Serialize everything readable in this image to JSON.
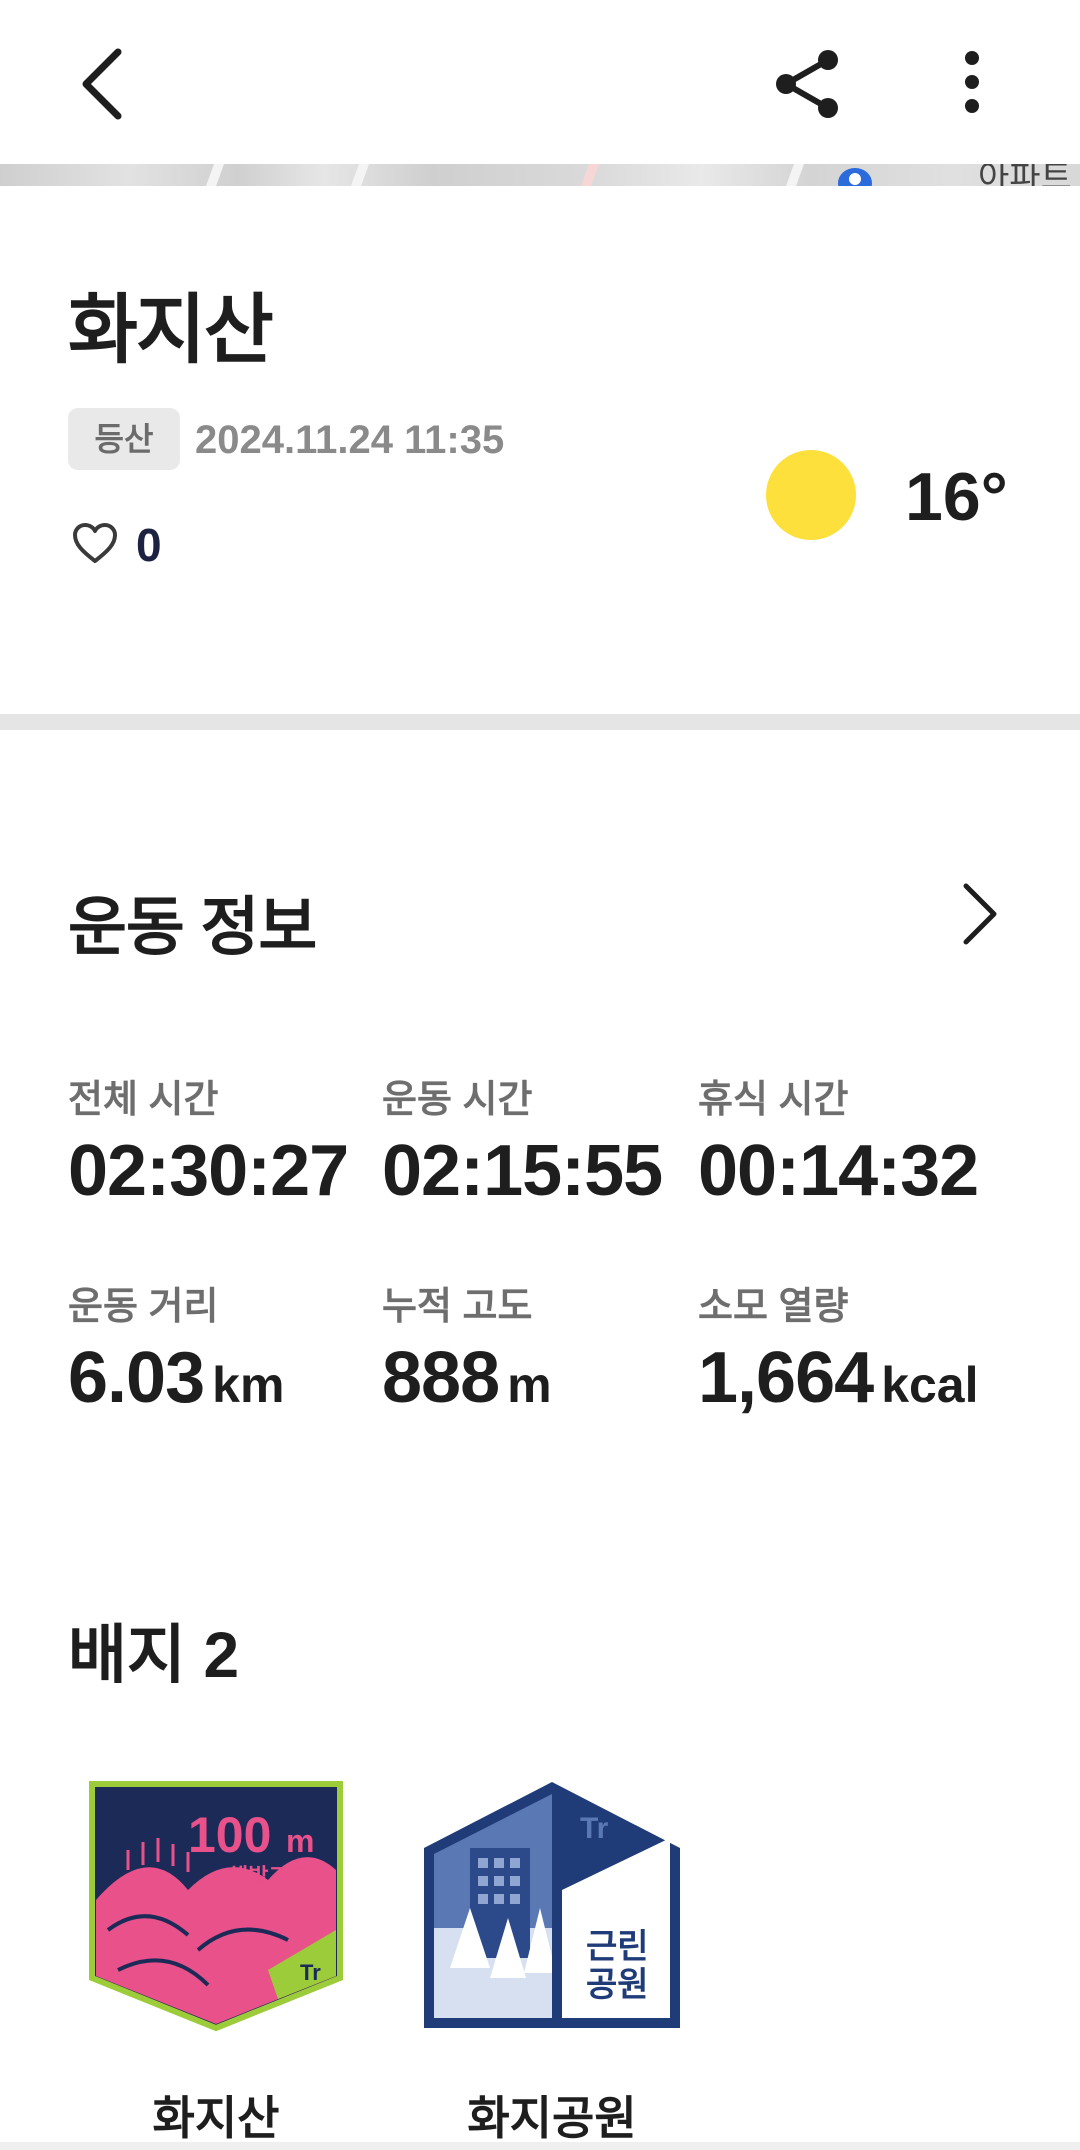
{
  "header": {
    "back_icon": "chevron-left-icon",
    "share_icon": "share-icon",
    "more_icon": "more-vertical-icon"
  },
  "map": {
    "label": "아파트"
  },
  "record": {
    "title": "화지산",
    "tag": "등산",
    "datetime": "2024.11.24 11:35",
    "like_count": "0",
    "weather_icon": "sun-icon",
    "temperature": "16°"
  },
  "exercise": {
    "section_title": "운동 정보",
    "stats": [
      {
        "label": "전체 시간",
        "value": "02:30:27",
        "unit": ""
      },
      {
        "label": "운동 시간",
        "value": "02:15:55",
        "unit": ""
      },
      {
        "label": "휴식 시간",
        "value": "00:14:32",
        "unit": ""
      },
      {
        "label": "운동 거리",
        "value": "6.03",
        "unit": "km"
      },
      {
        "label": "누적 고도",
        "value": "888",
        "unit": "m"
      },
      {
        "label": "소모 열량",
        "value": "1,664",
        "unit": "kcal"
      }
    ]
  },
  "badges": {
    "title": "배지 2",
    "items": [
      {
        "name": "화지산",
        "line1": "100",
        "unit": "m",
        "line2": "해발고도",
        "logo": "Tr"
      },
      {
        "name": "화지공원",
        "line1": "근린",
        "line2": "공원",
        "logo": "Tr"
      }
    ]
  },
  "colors": {
    "sun": "#fde03b",
    "badge_pink": "#e8518a",
    "badge_navy": "#1b2a57",
    "badge_green": "#9ccc3a",
    "badge_blue": "#1f3c78"
  }
}
